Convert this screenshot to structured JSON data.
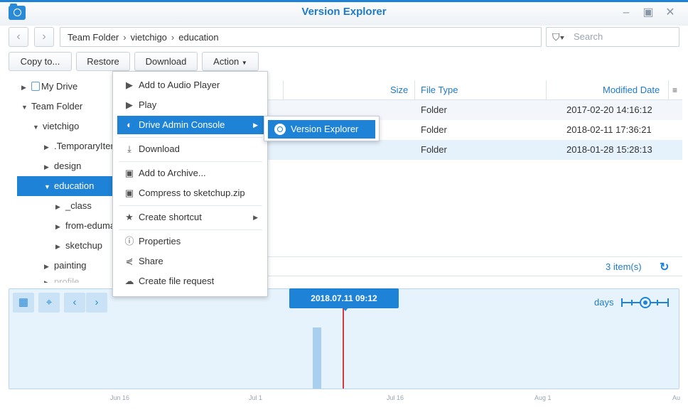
{
  "window": {
    "title": "Version Explorer",
    "controls": [
      "minimize",
      "maximize",
      "close"
    ]
  },
  "nav": {
    "back": "‹",
    "forward": "›"
  },
  "path": [
    "Team Folder",
    "vietchigo",
    "education"
  ],
  "search": {
    "placeholder": "Search"
  },
  "toolbar": {
    "copy_to": "Copy to...",
    "restore": "Restore",
    "download": "Download",
    "action": "Action"
  },
  "tree": [
    {
      "label": "My Drive",
      "depth": 0,
      "arrow": "▶"
    },
    {
      "label": "Team Folder",
      "depth": 0,
      "arrow": "▼"
    },
    {
      "label": "vietchigo",
      "depth": 1,
      "arrow": "▼"
    },
    {
      "label": ".TemporaryItems",
      "depth": 2,
      "arrow": "▶"
    },
    {
      "label": "design",
      "depth": 2,
      "arrow": "▶"
    },
    {
      "label": "education",
      "depth": 2,
      "arrow": "▼",
      "selected": true
    },
    {
      "label": "_class",
      "depth": 3,
      "arrow": "▶"
    },
    {
      "label": "from-edumall",
      "depth": 3,
      "arrow": "▶"
    },
    {
      "label": "sketchup",
      "depth": 3,
      "arrow": "▶"
    },
    {
      "label": "painting",
      "depth": 2,
      "arrow": "▶"
    },
    {
      "label": "profile",
      "depth": 2,
      "arrow": "▶"
    }
  ],
  "grid": {
    "columns": {
      "size": "Size",
      "type": "File Type",
      "modified": "Modified Date"
    },
    "rows": [
      {
        "type": "Folder",
        "modified": "2017-02-20 14:16:12"
      },
      {
        "type": "Folder",
        "modified": "2018-02-11 17:36:21"
      },
      {
        "type": "Folder",
        "modified": "2018-01-28 15:28:13"
      }
    ],
    "item_count": "3 item(s)"
  },
  "menu": {
    "items": [
      {
        "label": "Add to Audio Player",
        "icon": "play-icon"
      },
      {
        "label": "Play",
        "icon": "play-icon"
      },
      {
        "label": "Drive Admin Console",
        "icon": "drive-icon",
        "submenu": true,
        "highlighted": true
      },
      {
        "label": "Download",
        "icon": "download-icon"
      },
      {
        "label": "Add to Archive...",
        "icon": "archive-icon"
      },
      {
        "label": "Compress to sketchup.zip",
        "icon": "archive-icon"
      },
      {
        "label": "Create shortcut",
        "icon": "star-icon",
        "submenu": true
      },
      {
        "label": "Properties",
        "icon": "info-icon"
      },
      {
        "label": "Share",
        "icon": "share-icon"
      },
      {
        "label": "Create file request",
        "icon": "cloud-upload-icon"
      }
    ],
    "submenu_item": "Version Explorer"
  },
  "timeline": {
    "current": "2018.07.11 09:12",
    "scale": "days",
    "ticks": [
      "Jun 16",
      "Jul 1",
      "Jul 16",
      "Aug 1",
      "Au"
    ]
  },
  "colors": {
    "accent": "#1e83d6",
    "marker": "#d9363e",
    "timeline_bg": "#e7f3fc"
  }
}
